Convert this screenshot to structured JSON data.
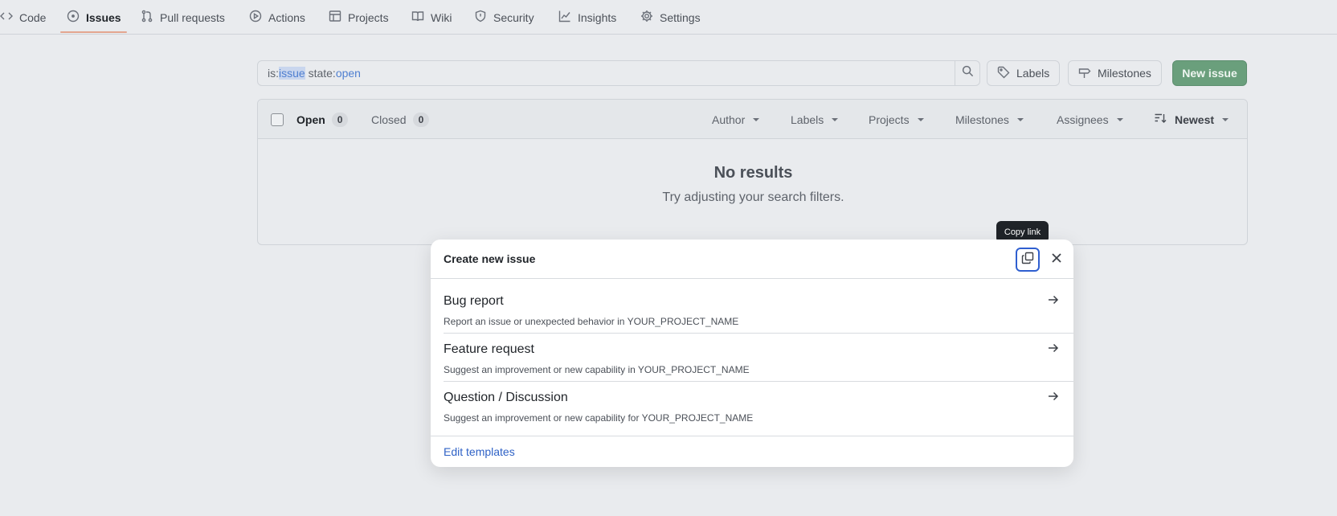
{
  "nav": {
    "items": [
      {
        "label": "Code",
        "icon": "code-icon"
      },
      {
        "label": "Issues",
        "icon": "issue-opened-icon",
        "active": true
      },
      {
        "label": "Pull requests",
        "icon": "git-pull-request-icon"
      },
      {
        "label": "Actions",
        "icon": "play-icon"
      },
      {
        "label": "Projects",
        "icon": "table-icon"
      },
      {
        "label": "Wiki",
        "icon": "book-icon"
      },
      {
        "label": "Security",
        "icon": "shield-icon"
      },
      {
        "label": "Insights",
        "icon": "graph-icon"
      },
      {
        "label": "Settings",
        "icon": "gear-icon"
      }
    ]
  },
  "search": {
    "prefix1": "is:",
    "token1": "issue",
    "prefix2": " state:",
    "token2": "open"
  },
  "toolbar": {
    "labels": "Labels",
    "milestones": "Milestones",
    "new_issue": "New issue"
  },
  "issues": {
    "open_label": "Open",
    "open_count": "0",
    "closed_label": "Closed",
    "closed_count": "0",
    "filters": {
      "author": "Author",
      "labels": "Labels",
      "projects": "Projects",
      "milestones": "Milestones",
      "assignees": "Assignees",
      "sort": "Newest"
    },
    "empty_title": "No results",
    "empty_subtitle": "Try adjusting your search filters."
  },
  "tooltip": "Copy link",
  "dialog": {
    "title": "Create new issue",
    "templates": [
      {
        "name": "Bug report",
        "description": "Report an issue or unexpected behavior in YOUR_PROJECT_NAME"
      },
      {
        "name": "Feature request",
        "description": "Suggest an improvement or new capability in YOUR_PROJECT_NAME"
      },
      {
        "name": "Question / Discussion",
        "description": "Suggest an improvement or new capability for YOUR_PROJECT_NAME"
      }
    ],
    "footer_link": "Edit templates"
  },
  "colors": {
    "accent_green": "#6a9f7c",
    "link_blue": "#2f62c6",
    "focus_blue": "#2f5fd0",
    "active_underline": "#e3a58f"
  }
}
